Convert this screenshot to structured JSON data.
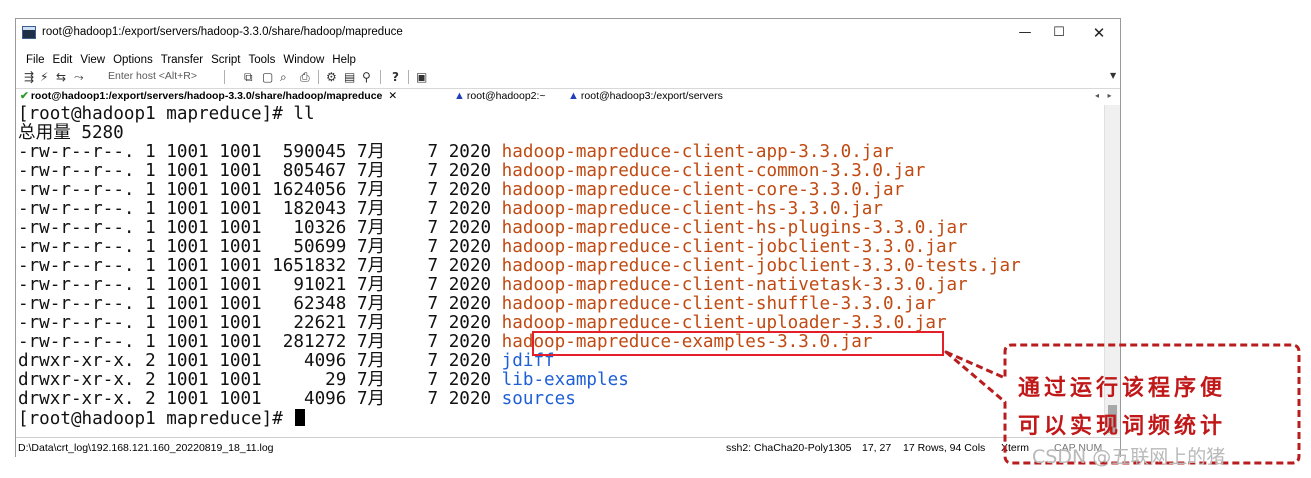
{
  "window": {
    "title": "root@hadoop1:/export/servers/hadoop-3.3.0/share/hadoop/mapreduce",
    "controls": {
      "minimize": "—",
      "maximize": "☐",
      "close": "✕"
    }
  },
  "menu": [
    "File",
    "Edit",
    "View",
    "Options",
    "Transfer",
    "Script",
    "Tools",
    "Window",
    "Help"
  ],
  "toolbar": {
    "host_placeholder": "Enter host <Alt+R>",
    "icons": [
      "connect-icon",
      "quick-connect-icon",
      "reconnect-icon",
      "disconnect-icon",
      "copy-icon",
      "paste-icon",
      "find-icon",
      "print-icon",
      "settings-icon",
      "keymap-icon",
      "sftp-icon",
      "help-icon",
      "screenshot-icon"
    ]
  },
  "tabs": [
    {
      "label": "root@hadoop1:/export/servers/hadoop-3.3.0/share/hadoop/mapreduce",
      "status": "connected",
      "active": true,
      "close": "✕"
    },
    {
      "label": "root@hadoop2:~",
      "status": "warning",
      "active": false
    },
    {
      "label": "root@hadoop3:/export/servers",
      "status": "warning",
      "active": false
    }
  ],
  "tab_nav": "◂ ▸",
  "terminal": {
    "prompt_cmd": "[root@hadoop1 mapreduce]# ll",
    "total": "总用量 5280",
    "entries": [
      {
        "meta": "-rw-r--r--. 1 1001 1001  590045 7月    7 2020 ",
        "name": "hadoop-mapreduce-client-app-3.3.0.jar",
        "kind": "jar"
      },
      {
        "meta": "-rw-r--r--. 1 1001 1001  805467 7月    7 2020 ",
        "name": "hadoop-mapreduce-client-common-3.3.0.jar",
        "kind": "jar"
      },
      {
        "meta": "-rw-r--r--. 1 1001 1001 1624056 7月    7 2020 ",
        "name": "hadoop-mapreduce-client-core-3.3.0.jar",
        "kind": "jar"
      },
      {
        "meta": "-rw-r--r--. 1 1001 1001  182043 7月    7 2020 ",
        "name": "hadoop-mapreduce-client-hs-3.3.0.jar",
        "kind": "jar"
      },
      {
        "meta": "-rw-r--r--. 1 1001 1001   10326 7月    7 2020 ",
        "name": "hadoop-mapreduce-client-hs-plugins-3.3.0.jar",
        "kind": "jar"
      },
      {
        "meta": "-rw-r--r--. 1 1001 1001   50699 7月    7 2020 ",
        "name": "hadoop-mapreduce-client-jobclient-3.3.0.jar",
        "kind": "jar"
      },
      {
        "meta": "-rw-r--r--. 1 1001 1001 1651832 7月    7 2020 ",
        "name": "hadoop-mapreduce-client-jobclient-3.3.0-tests.jar",
        "kind": "jar"
      },
      {
        "meta": "-rw-r--r--. 1 1001 1001   91021 7月    7 2020 ",
        "name": "hadoop-mapreduce-client-nativetask-3.3.0.jar",
        "kind": "jar"
      },
      {
        "meta": "-rw-r--r--. 1 1001 1001   62348 7月    7 2020 ",
        "name": "hadoop-mapreduce-client-shuffle-3.3.0.jar",
        "kind": "jar"
      },
      {
        "meta": "-rw-r--r--. 1 1001 1001   22621 7月    7 2020 ",
        "name": "hadoop-mapreduce-client-uploader-3.3.0.jar",
        "kind": "jar"
      },
      {
        "meta": "-rw-r--r--. 1 1001 1001  281272 7月    7 2020 ",
        "name": "hadoop-mapreduce-examples-3.3.0.jar",
        "kind": "jar"
      },
      {
        "meta": "drwxr-xr-x. 2 1001 1001    4096 7月    7 2020 ",
        "name": "jdiff",
        "kind": "dir"
      },
      {
        "meta": "drwxr-xr-x. 2 1001 1001      29 7月    7 2020 ",
        "name": "lib-examples",
        "kind": "dir"
      },
      {
        "meta": "drwxr-xr-x. 2 1001 1001    4096 7月    7 2020 ",
        "name": "sources",
        "kind": "dir"
      }
    ],
    "prompt_end": "[root@hadoop1 mapreduce]# ",
    "colors": {
      "jar": "#c04a12",
      "dir": "#1f5fd6",
      "text": "#111111"
    }
  },
  "status": {
    "log_path": "D:\\Data\\crt_log\\192.168.121.160_20220819_18_11.log",
    "session": "ssh2: ChaCha20-Poly1305",
    "position": "17, 27",
    "size": "17 Rows, 94 Cols",
    "terminal_type": "Xterm",
    "caps": "CAP NUM"
  },
  "annotation": {
    "callout_line1": "通过运行该程序便",
    "callout_line2": "可以实现词频统计",
    "color": "#c01818"
  },
  "watermark": "CSDN @五联网上的猪"
}
